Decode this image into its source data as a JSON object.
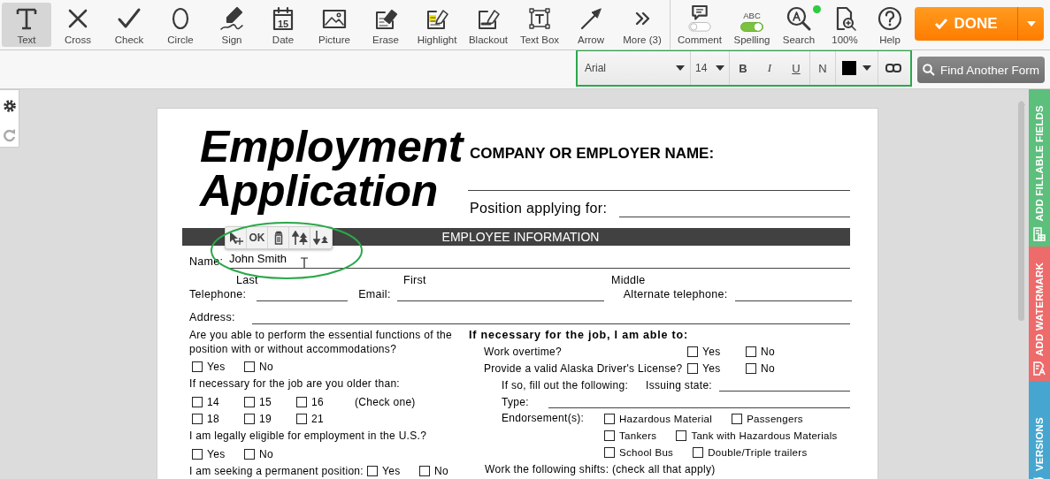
{
  "toolbar": {
    "tools": [
      {
        "label": "Text",
        "kind": "text",
        "selected": true
      },
      {
        "label": "Cross",
        "kind": "cross",
        "selected": false
      },
      {
        "label": "Check",
        "kind": "check",
        "selected": false
      },
      {
        "label": "Circle",
        "kind": "circle",
        "selected": false
      },
      {
        "label": "Sign",
        "kind": "sign",
        "selected": false
      },
      {
        "label": "Date",
        "kind": "date",
        "icon_text": "15",
        "selected": false
      },
      {
        "label": "Picture",
        "kind": "picture",
        "selected": false
      },
      {
        "label": "Erase",
        "kind": "erase",
        "selected": false
      },
      {
        "label": "Highlight",
        "kind": "highlight",
        "selected": false
      },
      {
        "label": "Blackout",
        "kind": "blackout",
        "selected": false
      },
      {
        "label": "Text Box",
        "kind": "textbox",
        "selected": false
      },
      {
        "label": "Arrow",
        "kind": "arrow",
        "selected": false
      },
      {
        "label": "More (3)",
        "kind": "more",
        "selected": false
      }
    ],
    "actions": [
      {
        "label": "Comment",
        "kind": "comment",
        "on": false
      },
      {
        "label": "Spelling",
        "kind": "spelling",
        "caption": "ABC",
        "on": true
      },
      {
        "label": "Search",
        "kind": "search",
        "notification": true
      },
      {
        "label": "100%",
        "kind": "zoom"
      },
      {
        "label": "Help",
        "kind": "help"
      }
    ],
    "done_button": {
      "label": "DONE"
    }
  },
  "format_bar": {
    "font": "Arial",
    "size": "14",
    "color": "#000000",
    "styles": [
      {
        "label": "B",
        "kind": "bold"
      },
      {
        "label": "I",
        "kind": "italic"
      },
      {
        "label": "U",
        "kind": "underline"
      },
      {
        "label": "N",
        "kind": "normal"
      }
    ],
    "find_button": {
      "label": "Find Another Form"
    }
  },
  "side_tabs": [
    {
      "label": "ADD FILLABLE FIELDS",
      "kind": "fields",
      "color": "#5cbf7b"
    },
    {
      "label": "ADD WATERMARK",
      "kind": "watermark",
      "color": "#ee6b6b"
    },
    {
      "label": "VERSIONS",
      "kind": "versions",
      "color": "#46a6cf"
    }
  ],
  "document": {
    "title": "Employment Application",
    "company_label": "COMPANY OR EMPLOYER NAME:",
    "position_label": "Position applying for:",
    "section_heading": "EMPLOYEE INFORMATION",
    "edit_popup": {
      "ok_label": "OK"
    },
    "text_entry": {
      "value": "John Smith"
    },
    "name_label": "Name:",
    "name_parts": [
      "Last",
      "First",
      "Middle"
    ],
    "contact_fields": [
      "Telephone:",
      "Email:",
      "Alternate telephone:"
    ],
    "address_label": "Address:",
    "left_column": [
      {
        "kind": "text",
        "text": "Are you able to perform the essential functions of the position with or without accommodations?"
      },
      {
        "kind": "options",
        "options": [
          {
            "label": "Yes",
            "checked": false
          },
          {
            "label": "No",
            "checked": false
          }
        ]
      },
      {
        "kind": "text",
        "text": "If necessary for the job are you older than:"
      },
      {
        "kind": "options",
        "options": [
          {
            "label": "14",
            "checked": false
          },
          {
            "label": "15",
            "checked": false
          },
          {
            "label": "16",
            "checked": false
          }
        ],
        "note": "(Check one)"
      },
      {
        "kind": "options",
        "options": [
          {
            "label": "18",
            "checked": false
          },
          {
            "label": "19",
            "checked": false
          },
          {
            "label": "21",
            "checked": false
          }
        ]
      },
      {
        "kind": "text",
        "text": "I am legally eligible for employment in the U.S.?"
      },
      {
        "kind": "options",
        "options": [
          {
            "label": "Yes",
            "checked": false
          },
          {
            "label": "No",
            "checked": false
          }
        ]
      },
      {
        "kind": "question",
        "text": "I am seeking a permanent position:",
        "options": [
          {
            "label": "Yes",
            "checked": false
          },
          {
            "label": "No",
            "checked": false
          }
        ]
      }
    ],
    "right_column": [
      {
        "kind": "heading",
        "text": "If necessary for the job, I am able to:"
      },
      {
        "kind": "question",
        "text": "Work overtime?",
        "options": [
          {
            "label": "Yes",
            "checked": false
          },
          {
            "label": "No",
            "checked": false
          }
        ]
      },
      {
        "kind": "question",
        "text": "Provide a valid Alaska Driver's License?",
        "options": [
          {
            "label": "Yes",
            "checked": false
          },
          {
            "label": "No",
            "checked": false
          }
        ]
      },
      {
        "kind": "fill",
        "text": "If so, fill out the following:",
        "field_label": "Issuing state:"
      },
      {
        "kind": "fill",
        "text": "Type:"
      },
      {
        "kind": "endorsements",
        "text": "Endorsement(s):",
        "rows": [
          [
            {
              "label": "Hazardous Material",
              "checked": false
            },
            {
              "label": "Passengers",
              "checked": false
            }
          ],
          [
            {
              "label": "Tankers",
              "checked": false
            },
            {
              "label": "Tank with Hazardous Materials",
              "checked": false
            }
          ],
          [
            {
              "label": "School Bus",
              "checked": false
            },
            {
              "label": "Double/Triple trailers",
              "checked": false
            }
          ]
        ]
      },
      {
        "kind": "text",
        "text": "Work the following shifts: (check all that apply)"
      }
    ]
  }
}
